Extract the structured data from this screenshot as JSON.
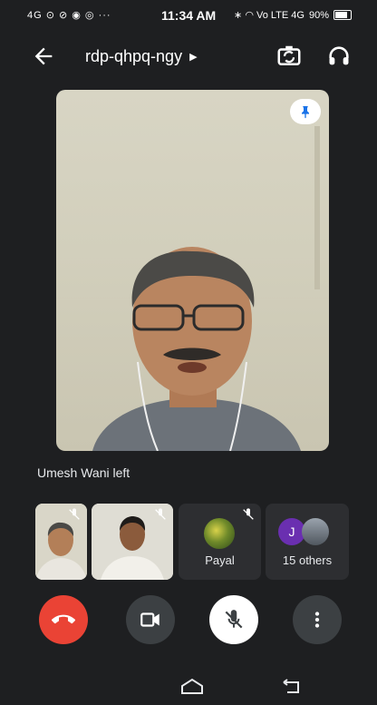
{
  "status_bar": {
    "left_icons": "4G ⊙ ⊘ ◉ ◎ ···",
    "time": "11:34 AM",
    "right_icons": "∗ ◠ Vo LTE 4G",
    "battery": "90%"
  },
  "header": {
    "meeting_code": "rdp-qhpq-ngy"
  },
  "notice": {
    "text": "Umesh Wani left"
  },
  "tiles": [
    {
      "name": ""
    },
    {
      "name": ""
    },
    {
      "name": "Payal"
    },
    {
      "name": "15 others",
      "avatar_letter": "J"
    }
  ],
  "colors": {
    "background": "#1e1f21",
    "end_call": "#ea4335",
    "control": "#3c4043",
    "mic_active_bg": "#ffffff",
    "avatar_purple": "#6a2fb0"
  },
  "icons": {
    "back": "arrow-left-icon",
    "switch_camera": "switch-camera-icon",
    "audio": "headphones-icon",
    "pin": "pin-icon",
    "end_call": "phone-hangup-icon",
    "video": "video-camera-icon",
    "mic": "mic-off-icon",
    "more": "more-vertical-icon",
    "nav_home": "home-icon",
    "nav_back": "back-icon"
  }
}
